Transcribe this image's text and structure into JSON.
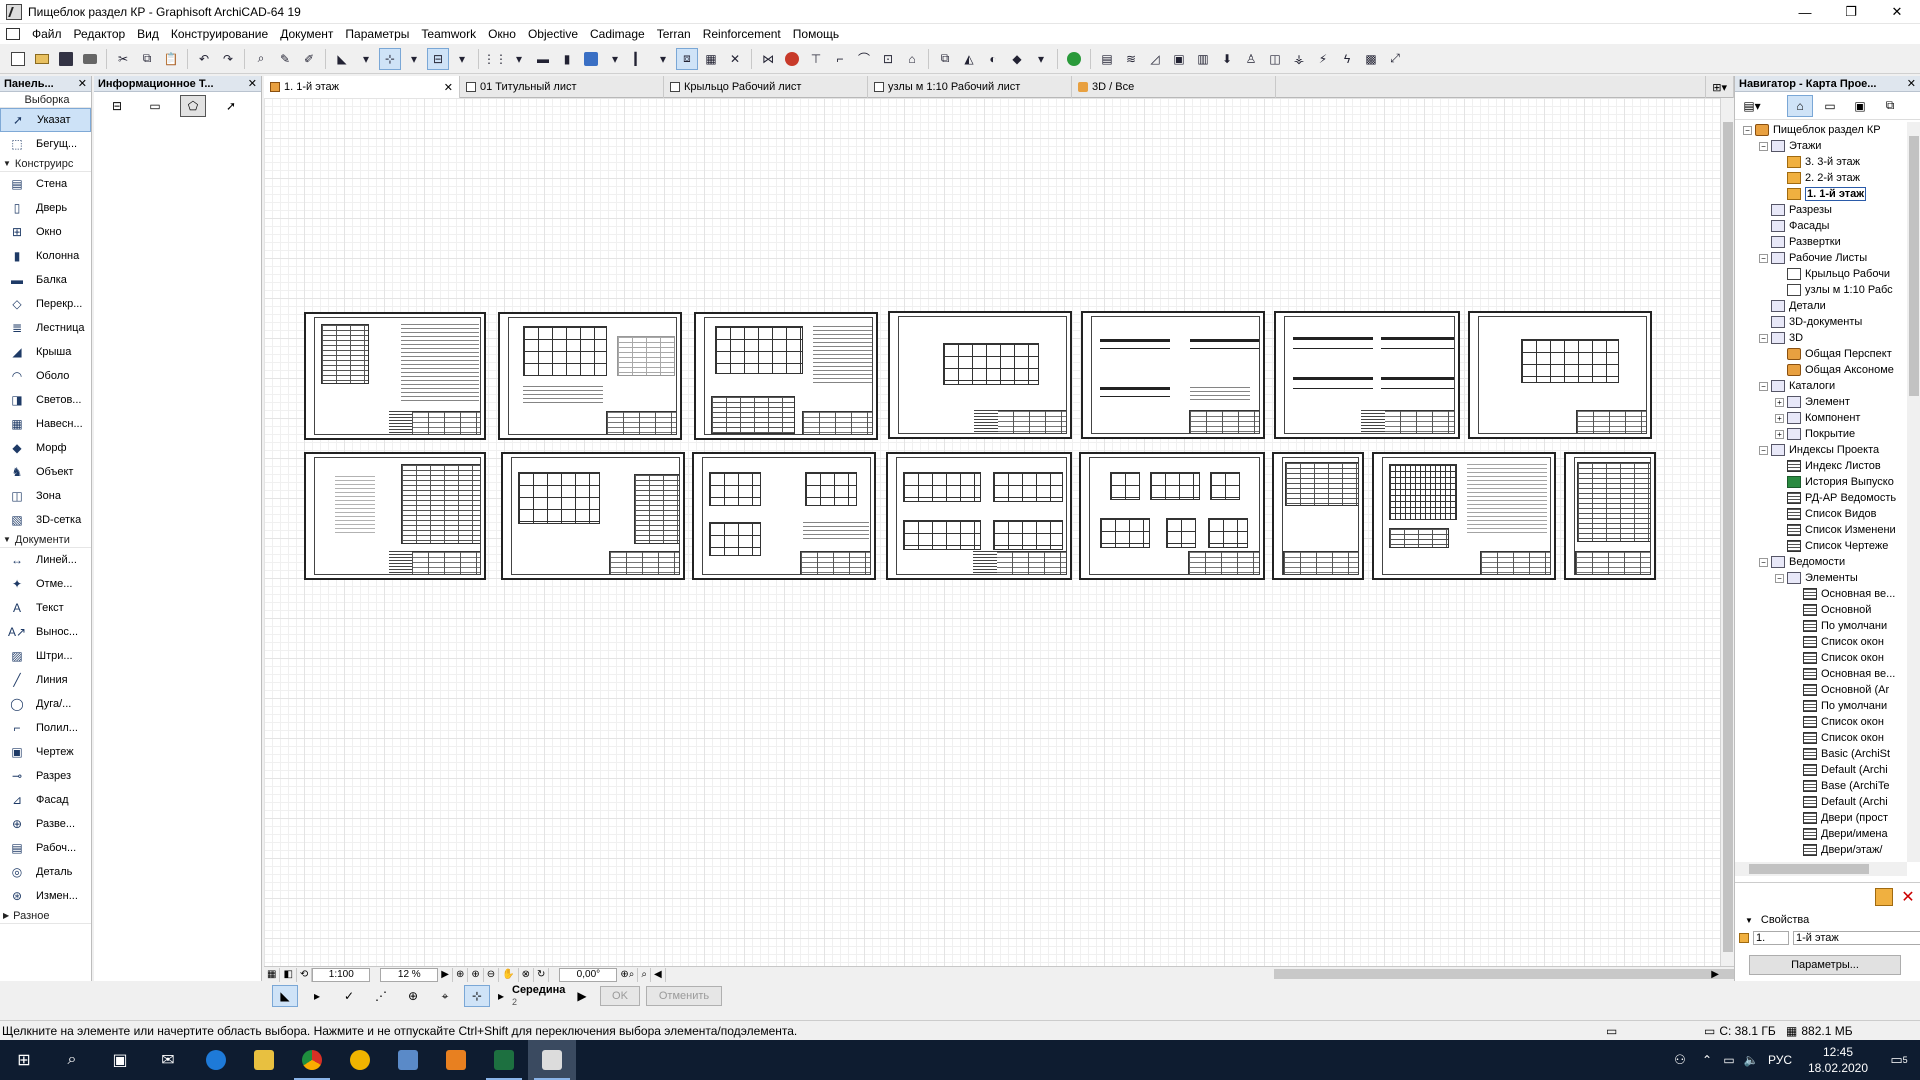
{
  "window": {
    "title": "Пищеблок раздел КР - Graphisoft ArchiCAD-64 19",
    "buttons": [
      "—",
      "❐",
      "✕"
    ]
  },
  "menu": [
    "Файл",
    "Редактор",
    "Вид",
    "Конструирование",
    "Документ",
    "Параметры",
    "Teamwork",
    "Окно",
    "Objective",
    "Cadimage",
    "Terran",
    "Reinforcement",
    "Помощь"
  ],
  "toolbox": {
    "title": "Панель...",
    "selection_header": "Выборка",
    "selection_tools": [
      {
        "label": "Указат",
        "icon": "arrow-pointer-icon",
        "selected": true
      },
      {
        "label": "Бегущ...",
        "icon": "marquee-icon",
        "selected": false
      }
    ],
    "construct_header": "Конструирс",
    "construct_tools": [
      {
        "label": "Стена",
        "icon": "wall-icon"
      },
      {
        "label": "Дверь",
        "icon": "door-icon"
      },
      {
        "label": "Окно",
        "icon": "window-icon"
      },
      {
        "label": "Колонна",
        "icon": "column-icon"
      },
      {
        "label": "Балка",
        "icon": "beam-icon"
      },
      {
        "label": "Перекр...",
        "icon": "slab-icon"
      },
      {
        "label": "Лестница",
        "icon": "stair-icon"
      },
      {
        "label": "Крыша",
        "icon": "roof-icon"
      },
      {
        "label": "Оболо",
        "icon": "shell-icon"
      },
      {
        "label": "Светов...",
        "icon": "skylight-icon"
      },
      {
        "label": "Навесн...",
        "icon": "curtain-wall-icon"
      },
      {
        "label": "Морф",
        "icon": "morph-icon"
      },
      {
        "label": "Объект",
        "icon": "object-icon"
      },
      {
        "label": "Зона",
        "icon": "zone-icon"
      },
      {
        "label": "3D-сетка",
        "icon": "mesh-icon"
      }
    ],
    "document_header": "Документи",
    "document_tools": [
      {
        "label": "Линей...",
        "icon": "dimension-icon"
      },
      {
        "label": "Отме...",
        "icon": "level-dimension-icon"
      },
      {
        "label": "Текст",
        "icon": "text-icon"
      },
      {
        "label": "Вынос...",
        "icon": "label-icon"
      },
      {
        "label": "Штри...",
        "icon": "fill-icon"
      },
      {
        "label": "Линия",
        "icon": "line-icon"
      },
      {
        "label": "Дуга/...",
        "icon": "arc-icon"
      },
      {
        "label": "Полил...",
        "icon": "polyline-icon"
      },
      {
        "label": "Чертеж",
        "icon": "drawing-icon"
      },
      {
        "label": "Разрез",
        "icon": "section-icon"
      },
      {
        "label": "Фасад",
        "icon": "elevation-icon"
      },
      {
        "label": "Разве...",
        "icon": "interior-elevation-icon"
      },
      {
        "label": "Рабоч...",
        "icon": "worksheet-icon"
      },
      {
        "label": "Деталь",
        "icon": "detail-icon"
      },
      {
        "label": "Измен...",
        "icon": "change-icon"
      }
    ],
    "more_header": "Разное"
  },
  "info_box": {
    "title": "Информационное Т..."
  },
  "tabs": [
    {
      "label": "1. 1-й этаж",
      "active": true,
      "icon": "story-icon"
    },
    {
      "label": "01 Титульный лист",
      "active": false,
      "icon": "layout-icon"
    },
    {
      "label": "Крыльцо Рабочий лист",
      "active": false,
      "icon": "worksheet-icon"
    },
    {
      "label": "узлы м 1:10 Рабочий лист",
      "active": false,
      "icon": "worksheet-icon"
    },
    {
      "label": "3D / Все",
      "active": false,
      "icon": "3d-icon"
    }
  ],
  "view_bar": {
    "scale": "1:100",
    "zoom": "12 %",
    "angle": "0,00°"
  },
  "bottom": {
    "snap_label": "Середина",
    "snap_value": "2",
    "ok": "OK",
    "cancel": "Отменить"
  },
  "status": {
    "hint": "Щелкните на элементе или начертите область выбора. Нажмите и не отпускайте Ctrl+Shift для переключения выбора элемента/подэлемента.",
    "disk": "С: 38.1 ГБ",
    "memory": "882.1 МБ"
  },
  "navigator": {
    "title": "Навигатор - Карта Прое...",
    "tree": [
      {
        "label": "Пищеблок раздел КР",
        "level": 0,
        "exp": "-",
        "icon": "d3"
      },
      {
        "label": "Этажи",
        "level": 1,
        "exp": "-",
        "icon": "folder"
      },
      {
        "label": "3. 3-й этаж",
        "level": 2,
        "exp": "",
        "icon": "story"
      },
      {
        "label": "2. 2-й этаж",
        "level": 2,
        "exp": "",
        "icon": "story"
      },
      {
        "label": "1. 1-й этаж",
        "level": 2,
        "exp": "",
        "icon": "story",
        "selected": true
      },
      {
        "label": "Разрезы",
        "level": 1,
        "exp": "",
        "icon": "folder"
      },
      {
        "label": "Фасады",
        "level": 1,
        "exp": "",
        "icon": "folder"
      },
      {
        "label": "Развертки",
        "level": 1,
        "exp": "",
        "icon": "folder"
      },
      {
        "label": "Рабочие Листы",
        "level": 1,
        "exp": "-",
        "icon": "folder"
      },
      {
        "label": "Крыльцо Рабочи",
        "level": 2,
        "exp": "",
        "icon": "sheetico"
      },
      {
        "label": "узлы м 1:10 Рабс",
        "level": 2,
        "exp": "",
        "icon": "sheetico"
      },
      {
        "label": "Детали",
        "level": 1,
        "exp": "",
        "icon": "folder"
      },
      {
        "label": "3D-документы",
        "level": 1,
        "exp": "",
        "icon": "folder"
      },
      {
        "label": "3D",
        "level": 1,
        "exp": "-",
        "icon": "folder"
      },
      {
        "label": "Общая Перспект",
        "level": 2,
        "exp": "",
        "icon": "d3"
      },
      {
        "label": "Общая Аксономе",
        "level": 2,
        "exp": "",
        "icon": "d3"
      },
      {
        "label": "Каталоги",
        "level": 1,
        "exp": "-",
        "icon": "folder"
      },
      {
        "label": "Элемент",
        "level": 2,
        "exp": "+",
        "icon": "folder"
      },
      {
        "label": "Компонент",
        "level": 2,
        "exp": "+",
        "icon": "folder"
      },
      {
        "label": "Покрытие",
        "level": 2,
        "exp": "+",
        "icon": "folder"
      },
      {
        "label": "Индексы Проекта",
        "level": 1,
        "exp": "-",
        "icon": "folder"
      },
      {
        "label": "Индекс Листов",
        "level": 2,
        "exp": "",
        "icon": "list"
      },
      {
        "label": "История Выпуско",
        "level": 2,
        "exp": "",
        "icon": "idx"
      },
      {
        "label": "РД-АР Ведомость",
        "level": 2,
        "exp": "",
        "icon": "list"
      },
      {
        "label": "Список Видов",
        "level": 2,
        "exp": "",
        "icon": "list"
      },
      {
        "label": "Список Изменени",
        "level": 2,
        "exp": "",
        "icon": "list"
      },
      {
        "label": "Список Чертеже",
        "level": 2,
        "exp": "",
        "icon": "list"
      },
      {
        "label": "Ведомости",
        "level": 1,
        "exp": "-",
        "icon": "folder"
      },
      {
        "label": "Элементы",
        "level": 2,
        "exp": "-",
        "icon": "folder"
      },
      {
        "label": "Основная ве...",
        "level": 3,
        "exp": "",
        "icon": "list"
      },
      {
        "label": "Основной",
        "level": 3,
        "exp": "",
        "icon": "list"
      },
      {
        "label": "По умолчани",
        "level": 3,
        "exp": "",
        "icon": "list"
      },
      {
        "label": "Список окон",
        "level": 3,
        "exp": "",
        "icon": "list"
      },
      {
        "label": "Список окон",
        "level": 3,
        "exp": "",
        "icon": "list"
      },
      {
        "label": "Основная ве...",
        "level": 3,
        "exp": "",
        "icon": "list"
      },
      {
        "label": "Основной (Ar",
        "level": 3,
        "exp": "",
        "icon": "list"
      },
      {
        "label": "По умолчани",
        "level": 3,
        "exp": "",
        "icon": "list"
      },
      {
        "label": "Список окон",
        "level": 3,
        "exp": "",
        "icon": "list"
      },
      {
        "label": "Список окон",
        "level": 3,
        "exp": "",
        "icon": "list"
      },
      {
        "label": "Basic (ArchiSt",
        "level": 3,
        "exp": "",
        "icon": "list"
      },
      {
        "label": "Default (Archi",
        "level": 3,
        "exp": "",
        "icon": "list"
      },
      {
        "label": "Base (ArchiTe",
        "level": 3,
        "exp": "",
        "icon": "list"
      },
      {
        "label": "Default (Archi",
        "level": 3,
        "exp": "",
        "icon": "list"
      },
      {
        "label": "Двери (прост",
        "level": 3,
        "exp": "",
        "icon": "list"
      },
      {
        "label": "Двери/имена",
        "level": 3,
        "exp": "",
        "icon": "list"
      },
      {
        "label": "Двери/этаж/",
        "level": 3,
        "exp": "",
        "icon": "list"
      }
    ],
    "props_header": "Свойства",
    "props_id": "1.",
    "props_name": "1-й этаж",
    "props_button": "Параметры..."
  },
  "taskbar": {
    "time": "12:45",
    "date": "18.02.2020",
    "lang": "РУС",
    "notif": "5"
  }
}
